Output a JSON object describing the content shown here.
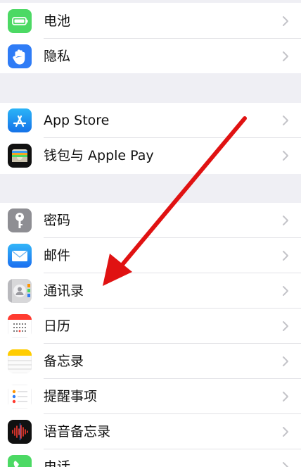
{
  "settings": {
    "groups": [
      {
        "items": [
          {
            "label": "电池",
            "icon": "battery-icon",
            "color": "#4cd964"
          },
          {
            "label": "隐私",
            "icon": "privacy-hand-icon",
            "color": "#2f7cf6"
          }
        ]
      },
      {
        "items": [
          {
            "label": "App Store",
            "icon": "app-store-icon",
            "color": "#1a8cf0"
          },
          {
            "label": "钱包与 Apple Pay",
            "icon": "wallet-icon",
            "color": "#111111"
          }
        ]
      },
      {
        "items": [
          {
            "label": "密码",
            "icon": "key-icon",
            "color": "#8e8e93"
          },
          {
            "label": "邮件",
            "icon": "mail-icon",
            "color": "#1f8df2"
          },
          {
            "label": "通讯录",
            "icon": "contacts-icon",
            "color": "#cfcfcf"
          },
          {
            "label": "日历",
            "icon": "calendar-icon",
            "color": "#ff3b30"
          },
          {
            "label": "备忘录",
            "icon": "notes-icon",
            "color": "#ffcc00"
          },
          {
            "label": "提醒事项",
            "icon": "reminders-icon",
            "color": "#ffffff"
          },
          {
            "label": "语音备忘录",
            "icon": "voice-memos-icon",
            "color": "#111111"
          },
          {
            "label": "电话",
            "icon": "phone-icon",
            "color": "#4cd964"
          }
        ]
      }
    ]
  },
  "annotation": {
    "arrow_color": "#e01212"
  }
}
